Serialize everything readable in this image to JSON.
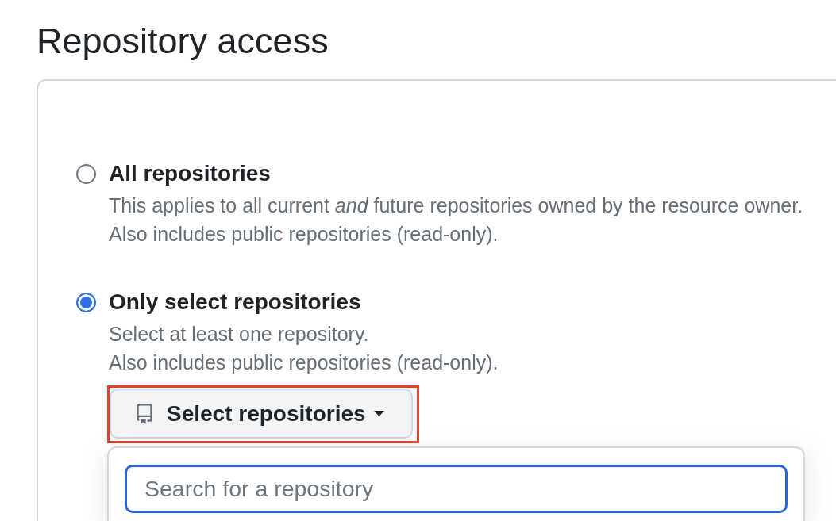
{
  "heading": "Repository access",
  "options": [
    {
      "label": "All repositories",
      "selected": false,
      "description": [
        "This applies to all current *and* future repositories owned by the resource owner.",
        "Also includes public repositories (read-only)."
      ]
    },
    {
      "label": "Only select repositories",
      "selected": true,
      "description": [
        "Select at least one repository.",
        "Also includes public repositories (read-only)."
      ],
      "picker": {
        "button": {
          "label": "Select repositories",
          "highlighted": true
        },
        "dropdown": {
          "expanded": true,
          "search": {
            "placeholder": "Search for a repository"
          }
        }
      }
    }
  ]
}
